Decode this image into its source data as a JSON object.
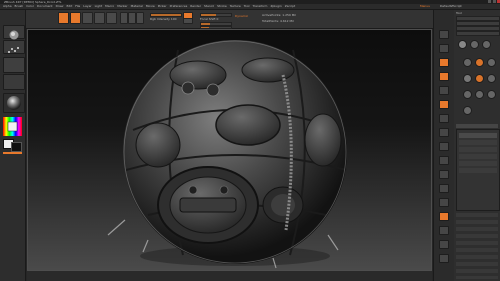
{
  "app": {
    "title": "ZBrush 4R7 [DEMO] Sphere_Droid.ZTL"
  },
  "menu": {
    "items": [
      "Alpha",
      "Brush",
      "Color",
      "Document",
      "Draw",
      "Edit",
      "File",
      "Layer",
      "Light",
      "Macro",
      "Marker",
      "Material",
      "Movie",
      "Picker",
      "Preferences",
      "Render",
      "Stencil",
      "Stroke",
      "Texture",
      "Tool",
      "Transform",
      "Zplugin",
      "Zscript"
    ],
    "right_items": [
      "Menus",
      "DefaultZScript"
    ]
  },
  "shelf": {
    "lightbox": "LightBox",
    "buttons": [
      "Edit",
      "Draw",
      "Move",
      "Scale",
      "Rotate"
    ],
    "mrgb": "Mrgb",
    "rgb": "Rgb",
    "m": "M",
    "rgb_intensity": "Rgb Intensity 100",
    "zadd": "Zadd",
    "zsub": "Zsub",
    "focal_shift": "Focal Shift 0",
    "draw_size": "Draw Size 64",
    "dynamic": "Dynamic",
    "z_intensity": "Z Intensity 25",
    "active_points": "ActivePoints: 1.259 Mil",
    "total_points": "TotalPoints: 4.612 Mil"
  },
  "left": {
    "brush": "Standard",
    "stroke": "DragRect",
    "alpha": "Alpha Off",
    "texture": "Texture Off",
    "material": "MatCap Gray",
    "gradient": "Gradient",
    "switch_color": "SwitchColor",
    "alternate": "Alternate"
  },
  "right_strip": {
    "buttons": [
      "BPR",
      "SPix 3",
      "Scroll",
      "Zoom",
      "Actual",
      "AAHalf",
      "Persp",
      "Floor",
      "Local",
      "L.Sym",
      "XYZ",
      "Frame",
      "Move",
      "Scale",
      "Rotate",
      "PolyF",
      "Transp",
      "Solo",
      "Dynamic",
      "Xpose"
    ]
  },
  "tray": {
    "header": "Tool",
    "load_tool": "Load Tool",
    "save_as": "Save As",
    "copy_tool": "Copy Tool",
    "paste_tool": "Paste Tool",
    "import": "Import",
    "export": "Export",
    "clone": "Clone",
    "make_polymesh": "Make PolyMesh3D",
    "goz": "GoZ",
    "all": "All",
    "visible": "Visible",
    "r": "R",
    "lightbox_tools": "Lightbox > Tools",
    "tool_name": "Sphere_Droid. 48",
    "subtool": "SubTool",
    "geometry": "Geometry",
    "layers": "Layers",
    "fibermesh": "FiberMesh",
    "geometry_hd": "Geometry HD",
    "preview": "Preview",
    "surface": "Surface",
    "deformation": "Deformation",
    "masking": "Masking",
    "visibility": "Visibility",
    "polygroups": "Polygroups",
    "contact": "Contact",
    "morph_target": "Morph Target",
    "polypaint": "Polypaint",
    "uv_map": "UV Map",
    "texture_map": "Texture Map"
  },
  "viewport_subject": "sphere-droid-model",
  "colors": {
    "accent": "#e8792c",
    "panel": "#2e2e2e",
    "viewport_top": "#0d0d0d",
    "viewport_bottom": "#4a4a4a"
  }
}
